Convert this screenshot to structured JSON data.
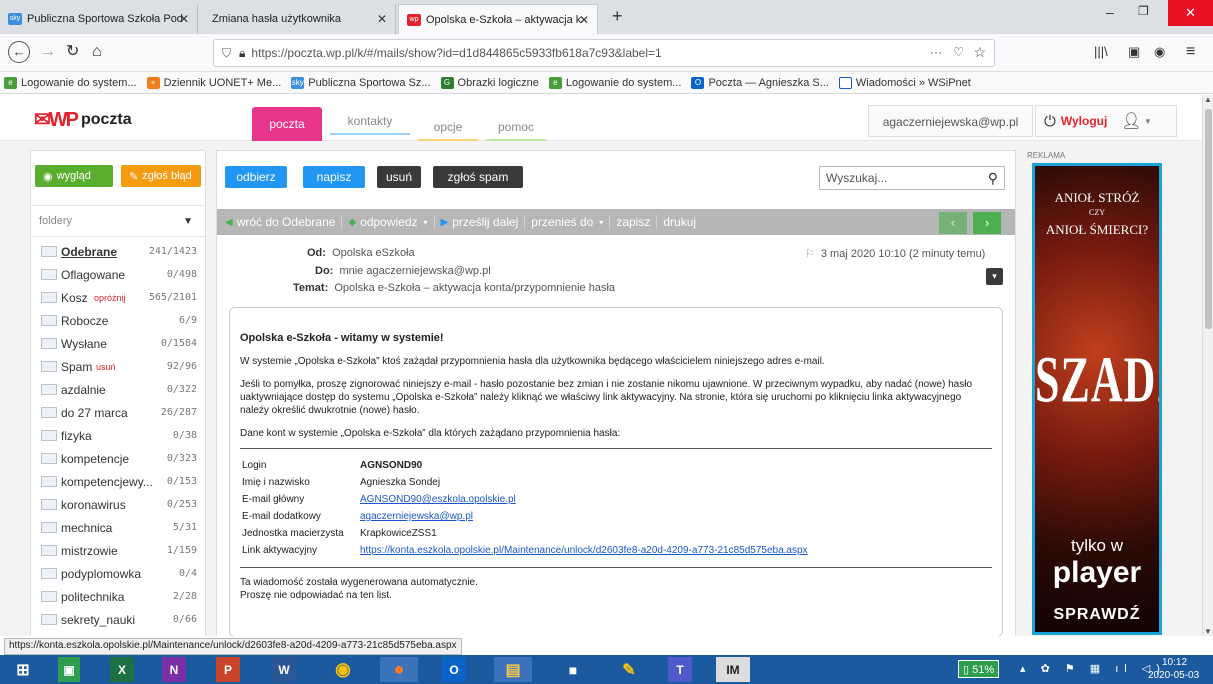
{
  "browser": {
    "tabs": [
      {
        "label": "Publiczna Sportowa Szkoła Pod",
        "active": false,
        "fav": "sky"
      },
      {
        "label": "Zmiana hasła użytkownika",
        "active": false,
        "fav": ""
      },
      {
        "label": "Opolska e-Szkoła – aktywacja k",
        "active": true,
        "fav": "wp"
      }
    ],
    "new_tab": "+",
    "url": "https://poczta.wp.pl/k/#/mails/show?id=d1d844865c5933fb618a7c93&label=1",
    "url_more": "···",
    "bookmarks": [
      "Logowanie do system...",
      "Dziennik UONET+ Me...",
      "Publiczna Sportowa Sz...",
      "Obrazki logiczne",
      "Logowanie do system...",
      "Poczta — Agnieszka S...",
      "Wiadomości » WSiPnet"
    ]
  },
  "app": {
    "logo_text": "poczta",
    "tabs": [
      "poczta",
      "kontakty",
      "opcje",
      "pomoc"
    ],
    "user_email": "agaczerniejewska@wp.pl",
    "logout": "Wyloguj"
  },
  "sidebar": {
    "view_btn": "wygląd",
    "report_btn": "zgłoś błąd",
    "folders_label": "foldery",
    "folders": [
      {
        "name": "Odebrane",
        "count": "241/1423",
        "bold": true
      },
      {
        "name": "Oflagowane",
        "count": "0/498"
      },
      {
        "name": "Kosz",
        "extra": "opróżnij",
        "count": "565/2101"
      },
      {
        "name": "Robocze",
        "count": "6/9"
      },
      {
        "name": "Wysłane",
        "count": "0/1584"
      },
      {
        "name": "Spam",
        "extra": "usuń",
        "count": "92/96"
      },
      {
        "name": "azdalnie",
        "count": "0/322"
      },
      {
        "name": "do 27 marca",
        "count": "26/287"
      },
      {
        "name": "fizyka",
        "count": "0/38"
      },
      {
        "name": "kompetencje",
        "count": "0/323"
      },
      {
        "name": "kompetencjewy...",
        "count": "0/153"
      },
      {
        "name": "koronawirus",
        "count": "0/253"
      },
      {
        "name": "mechnica",
        "count": "5/31"
      },
      {
        "name": "mistrzowie",
        "count": "1/159"
      },
      {
        "name": "podyplomowka",
        "count": "0/4"
      },
      {
        "name": "politechnika",
        "count": "2/28"
      },
      {
        "name": "sekrety_nauki",
        "count": "0/66"
      },
      {
        "name": "snit",
        "count": "35/304"
      }
    ]
  },
  "toolbar": {
    "receive": "odbierz",
    "write": "napisz",
    "delete": "usuń",
    "spam": "zgłoś spam",
    "search_placeholder": "Wyszukaj..."
  },
  "actions": {
    "back": "wróć do Odebrane",
    "reply": "odpowiedz",
    "forward": "prześlij dalej",
    "move": "przenieś do",
    "save": "zapisz",
    "print": "drukuj"
  },
  "message": {
    "from_label": "Od:",
    "from": "Opolska eSzkoła",
    "to_label": "Do:",
    "to": "mnie  agaczerniejewska@wp.pl",
    "subject_label": "Temat:",
    "subject": "Opolska e-Szkoła – aktywacja konta/przypomnienie hasła",
    "date": "3 maj 2020 10:10 (2 minuty temu)",
    "heading": "Opolska e-Szkoła - witamy w systemie!",
    "p1": "W systemie „Opolska e-Szkoła” ktoś zażądał przypomnienia hasła dla użytkownika będącego właścicielem niniejszego adres e-mail.",
    "p2": "Jeśli to pomyłka, proszę zignorować niniejszy e-mail - hasło pozostanie bez zmian i nie zostanie nikomu ujawnione. W przeciwnym wypadku, aby nadać (nowe) hasło uaktywniające dostęp do systemu „Opolska e-Szkoła” należy kliknąć we właściwy link aktywacyjny. Na stronie, która się uruchomi po kliknięciu linka aktywacyjnego należy określić dwukrotnie (nowe) hasło.",
    "p3": "Dane kont w systemie „Opolska e-Szkoła” dla których zażądano przypomnienia hasła:",
    "rows": [
      {
        "k": "Login",
        "v": "AGNSOND90",
        "type": "bold"
      },
      {
        "k": "Imię i nazwisko",
        "v": "Agnieszka Sondej",
        "type": "text"
      },
      {
        "k": "E-mail główny",
        "v": "AGNSOND90@eszkola.opolskie.pl",
        "type": "link"
      },
      {
        "k": "E-mail dodatkowy",
        "v": "agaczerniejewska@wp.pl",
        "type": "link"
      },
      {
        "k": "Jednostka macierzysta",
        "v": "KrapkowiceZSS1",
        "type": "text"
      },
      {
        "k": "Link aktywacyjny",
        "v": "https://konta.eszkola.opolskie.pl/Maintenance/unlock/d2603fe8-a20d-4209-a773-21c85d575eba.aspx",
        "type": "link"
      }
    ],
    "footer1": "Ta wiadomość została wygenerowana automatycznie.",
    "footer2": "Proszę nie odpowiadać na ten list."
  },
  "ad": {
    "label": "REKLAMA",
    "line1": "ANIOŁ STRÓŻ",
    "line2": "CZY",
    "line3": "ANIOŁ ŚMIERCI?",
    "title": "SZADŹ",
    "tag1": "tylko w",
    "tag2": "player",
    "cta": "SPRAWDŹ"
  },
  "status_url": "https://konta.eszkola.opolskie.pl/Maintenance/unlock/d2603fe8-a20d-4209-a773-21c85d575eba.aspx",
  "taskbar": {
    "battery": "51%",
    "time": "10:12",
    "date": "2020-05-03"
  },
  "colors": {
    "accent_pink": "#e8348a",
    "btn_blue": "#2196f3",
    "btn_dark": "#3a3a3a",
    "green": "#4caf50",
    "orange": "#f39c12"
  }
}
